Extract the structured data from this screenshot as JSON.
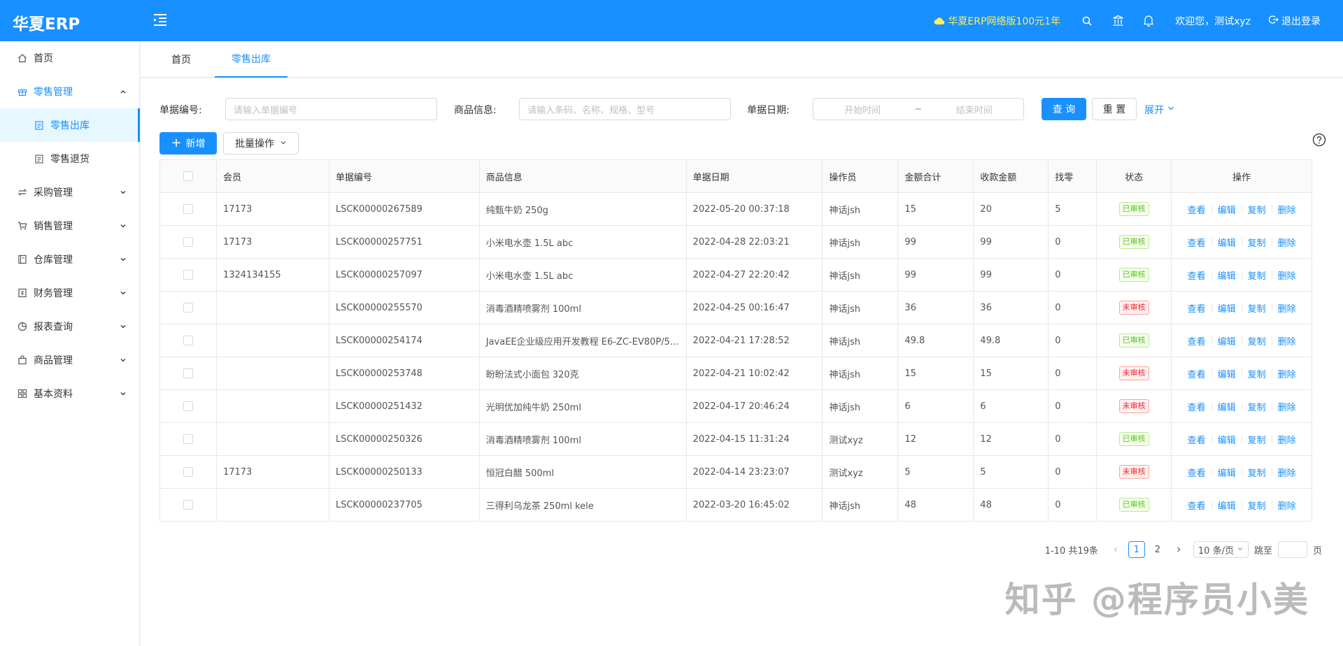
{
  "header": {
    "logo": "华夏ERP",
    "promo": "华夏ERP网络版100元1年",
    "welcome": "欢迎您，测试xyz",
    "logout": "退出登录"
  },
  "sidebar": {
    "items": [
      {
        "label": "首页",
        "icon": "home-icon"
      },
      {
        "label": "零售管理",
        "icon": "gift-icon"
      },
      {
        "label": "零售出库",
        "icon": "doc-icon"
      },
      {
        "label": "零售退货",
        "icon": "doc-icon"
      },
      {
        "label": "采购管理",
        "icon": "swap-icon"
      },
      {
        "label": "销售管理",
        "icon": "cart-icon"
      },
      {
        "label": "仓库管理",
        "icon": "book-icon"
      },
      {
        "label": "财务管理",
        "icon": "money-icon"
      },
      {
        "label": "报表查询",
        "icon": "pie-chart-icon"
      },
      {
        "label": "商品管理",
        "icon": "shopping-icon"
      },
      {
        "label": "基本资料",
        "icon": "appstore-icon"
      }
    ]
  },
  "tabs": [
    {
      "label": "首页"
    },
    {
      "label": "零售出库"
    }
  ],
  "search": {
    "number_label": "单据编号:",
    "number_placeholder": "请输入单据编号",
    "goods_label": "商品信息:",
    "goods_placeholder": "请输入条码、名称、规格、型号",
    "date_label": "单据日期:",
    "start_placeholder": "开始时间",
    "tilde": "~",
    "end_placeholder": "结束时间",
    "query": "查 询",
    "reset": "重 置",
    "expand": "展开"
  },
  "toolbar": {
    "add": "新增",
    "batch": "批量操作"
  },
  "table": {
    "columns": [
      "会员",
      "单据编号",
      "商品信息",
      "单据日期",
      "操作员",
      "金额合计",
      "收款金额",
      "找零",
      "状态",
      "操作"
    ],
    "ops": [
      "查看",
      "编辑",
      "复制",
      "删除"
    ],
    "rows": [
      {
        "member": "17173",
        "number": "LSCK00000267589",
        "goods": "纯甄牛奶 250g",
        "date": "2022-05-20 00:37:18",
        "operator": "神话jsh",
        "total": "15",
        "paid": "20",
        "change": "5",
        "status": "已审核",
        "ok": true
      },
      {
        "member": "17173",
        "number": "LSCK00000257751",
        "goods": "小米电水壶 1.5L abc",
        "date": "2022-04-28 22:03:21",
        "operator": "神话jsh",
        "total": "99",
        "paid": "99",
        "change": "0",
        "status": "已审核",
        "ok": true
      },
      {
        "member": "1324134155",
        "number": "LSCK00000257097",
        "goods": "小米电水壶 1.5L abc",
        "date": "2022-04-27 22:20:42",
        "operator": "神话jsh",
        "total": "99",
        "paid": "99",
        "change": "0",
        "status": "已审核",
        "ok": true
      },
      {
        "member": "",
        "number": "LSCK00000255570",
        "goods": "消毒酒精喷雾剂 100ml",
        "date": "2022-04-25 00:16:47",
        "operator": "神话jsh",
        "total": "36",
        "paid": "36",
        "change": "0",
        "status": "未审核",
        "ok": false
      },
      {
        "member": "",
        "number": "LSCK00000254174",
        "goods": "JavaEE企业级应用开发教程 E6-ZC-EV80P/5...",
        "date": "2022-04-21 17:28:52",
        "operator": "神话jsh",
        "total": "49.8",
        "paid": "49.8",
        "change": "0",
        "status": "已审核",
        "ok": true
      },
      {
        "member": "",
        "number": "LSCK00000253748",
        "goods": "盼盼法式小面包 320克",
        "date": "2022-04-21 10:02:42",
        "operator": "神话jsh",
        "total": "15",
        "paid": "15",
        "change": "0",
        "status": "未审核",
        "ok": false
      },
      {
        "member": "",
        "number": "LSCK00000251432",
        "goods": "光明优加纯牛奶 250ml",
        "date": "2022-04-17 20:46:24",
        "operator": "神话jsh",
        "total": "6",
        "paid": "6",
        "change": "0",
        "status": "未审核",
        "ok": false
      },
      {
        "member": "",
        "number": "LSCK00000250326",
        "goods": "消毒酒精喷雾剂 100ml",
        "date": "2022-04-15 11:31:24",
        "operator": "测试xyz",
        "total": "12",
        "paid": "12",
        "change": "0",
        "status": "已审核",
        "ok": true
      },
      {
        "member": "17173",
        "number": "LSCK00000250133",
        "goods": "恒冠白醋 500ml",
        "date": "2022-04-14 23:23:07",
        "operator": "测试xyz",
        "total": "5",
        "paid": "5",
        "change": "0",
        "status": "未审核",
        "ok": false
      },
      {
        "member": "",
        "number": "LSCK00000237705",
        "goods": "三得利乌龙茶 250ml kele",
        "date": "2022-03-20 16:45:02",
        "operator": "神话jsh",
        "total": "48",
        "paid": "48",
        "change": "0",
        "status": "已审核",
        "ok": true
      }
    ]
  },
  "pagination": {
    "summary": "1-10 共19条",
    "pages": [
      "1",
      "2"
    ],
    "current": "1",
    "size": "10 条/页",
    "jump_prefix": "跳至",
    "jump_suffix": "页"
  },
  "watermark": "知乎 @程序员小美",
  "colors": {
    "primary": "#1890ff",
    "success": "#52c41a",
    "danger": "#f5222d"
  }
}
